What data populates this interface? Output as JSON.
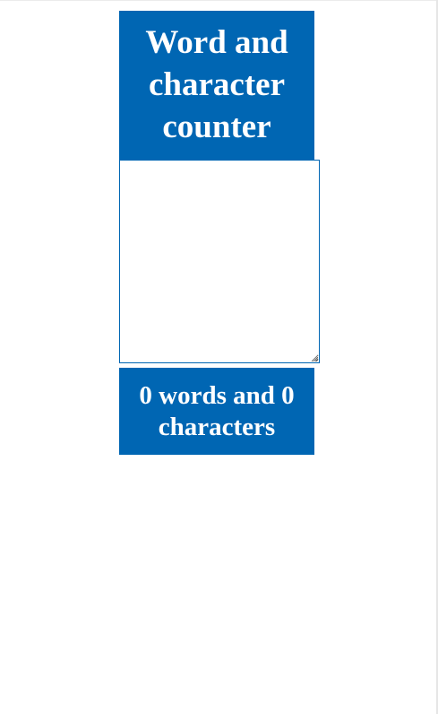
{
  "header": {
    "title": "Word and character counter"
  },
  "editor": {
    "value": "",
    "placeholder": ""
  },
  "counter": {
    "text": "0 words and 0 characters"
  },
  "colors": {
    "accent": "#0066b3",
    "text_on_accent": "#ffffff",
    "background": "#ffffff"
  }
}
